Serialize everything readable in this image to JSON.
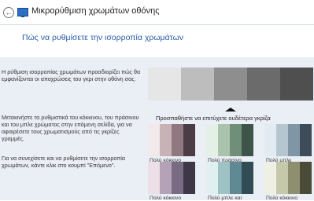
{
  "window": {
    "back_icon": "back-arrow-icon",
    "app_icon": "display-icon",
    "title": "Μικρορύθμιση χρωμάτων οθόνης"
  },
  "page": {
    "heading": "Πώς να ρυθμίσετε την ισορροπία χρωμάτων",
    "paragraphs": [
      "Η ρύθμιση ισορροπίας χρωμάτων προσδιορίζει πώς θα εμφανίζονται οι αποχρώσεις του γκρι στην οθόνη σας.",
      "Μετακινήστε τα ρυθμιστικά του κόκκινου, του πράσινου και του μπλε χρώματος στην επόμενη σελίδα, για να αφαιρέσετε τους χρωματισμούς από τις γκρίζες γραμμές.",
      "Για να συνεχίσετε και να ρυθμίσετε την ισορροπία χρωμάτων, κάντε κλικ στο κουμπί \"Επόμενο\"."
    ],
    "instruction": "Προσπαθήστε να επιτύχετε ουδέτερα γκρίζα"
  },
  "gray_swatches": [
    "#e6e6e6",
    "#bdbdbd",
    "#8e8e8e",
    "#6b6b6b",
    "#4f4f4f"
  ],
  "examples": [
    {
      "label": "Πολύ κόκκινο",
      "colors": [
        "#f2eaea",
        "#c7b3b5",
        "#8f7880",
        "#4a3d45"
      ]
    },
    {
      "label": "Πολύ πράσινο",
      "colors": [
        "#e4efe5",
        "#a9c3ad",
        "#6f8f78",
        "#3f5448"
      ]
    },
    {
      "label": "Πολύ μπλε",
      "colors": [
        "#e2ebf1",
        "#b5c6d1",
        "#8096a6",
        "#3d4c58"
      ]
    },
    {
      "label": "Πολύ κόκκινο",
      "colors": [
        "#ecdfe6",
        "#b5a2b6",
        "#7a6b84",
        "#3e3748"
      ]
    },
    {
      "label": "Πολύ μπλε και",
      "colors": [
        "#e0efef",
        "#9fc2c4",
        "#5f8a93",
        "#324c55"
      ]
    },
    {
      "label": "Πολύ κόκκινο",
      "colors": [
        "#eef0e4",
        "#c6c8aa",
        "#8e8f6e",
        "#4a4a38"
      ]
    }
  ]
}
